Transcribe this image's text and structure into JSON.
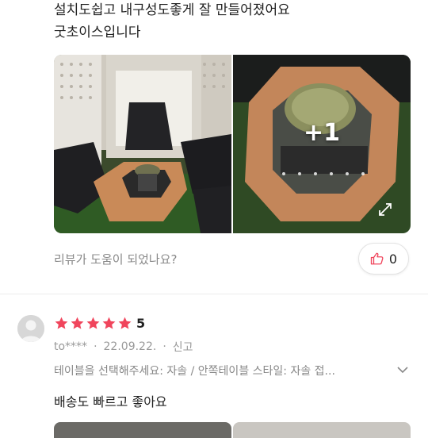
{
  "review_top": {
    "text_line1": "설치도쉽고 내구성도좋게 잘 만들어졌어요",
    "text_line2": "굿초이스입니다",
    "photos": {
      "more_count_label": "+1"
    },
    "helpful_question": "리뷰가 도움이 되었나요?",
    "helpful_count": "0"
  },
  "review_second": {
    "rating_stars": 5,
    "rating_value": "5",
    "author": "to****",
    "date": "22.09.22.",
    "report_label": "신고",
    "options_text": "테이블을 선택해주세요: 자솔 / 안쪽테이블 스타일: 자솔 접...",
    "comment": "배송도 빠르고 좋아요"
  },
  "colors": {
    "star": "#f0455c",
    "muted_text": "#888888",
    "thumb_icon": "#f0455c"
  },
  "icons": [
    "thumb-up-icon",
    "star-icon",
    "chevron-down-icon",
    "expand-icon",
    "avatar-placeholder-icon"
  ]
}
